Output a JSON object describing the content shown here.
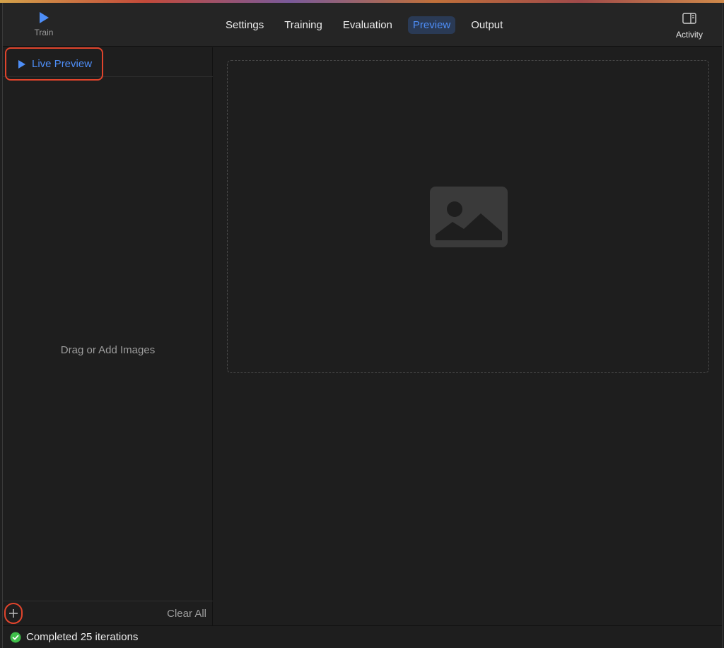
{
  "toolbar": {
    "train_label": "Train",
    "activity_label": "Activity",
    "tabs": [
      {
        "label": "Settings",
        "active": false
      },
      {
        "label": "Training",
        "active": false
      },
      {
        "label": "Evaluation",
        "active": false
      },
      {
        "label": "Preview",
        "active": true
      },
      {
        "label": "Output",
        "active": false
      }
    ]
  },
  "sidebar": {
    "live_preview_label": "Live Preview",
    "drag_hint": "Drag or Add Images",
    "clear_all_label": "Clear All"
  },
  "status": {
    "text": "Completed 25 iterations",
    "icon": "checkmark-circle-icon"
  },
  "colors": {
    "accent": "#4e8ef7",
    "highlight_outline": "#e0442c",
    "success": "#3fbf4a"
  },
  "icons": {
    "train": "play-icon",
    "activity": "sidebar-panel-icon",
    "live_preview": "play-icon",
    "add": "plus-icon",
    "placeholder": "image-placeholder-icon"
  }
}
